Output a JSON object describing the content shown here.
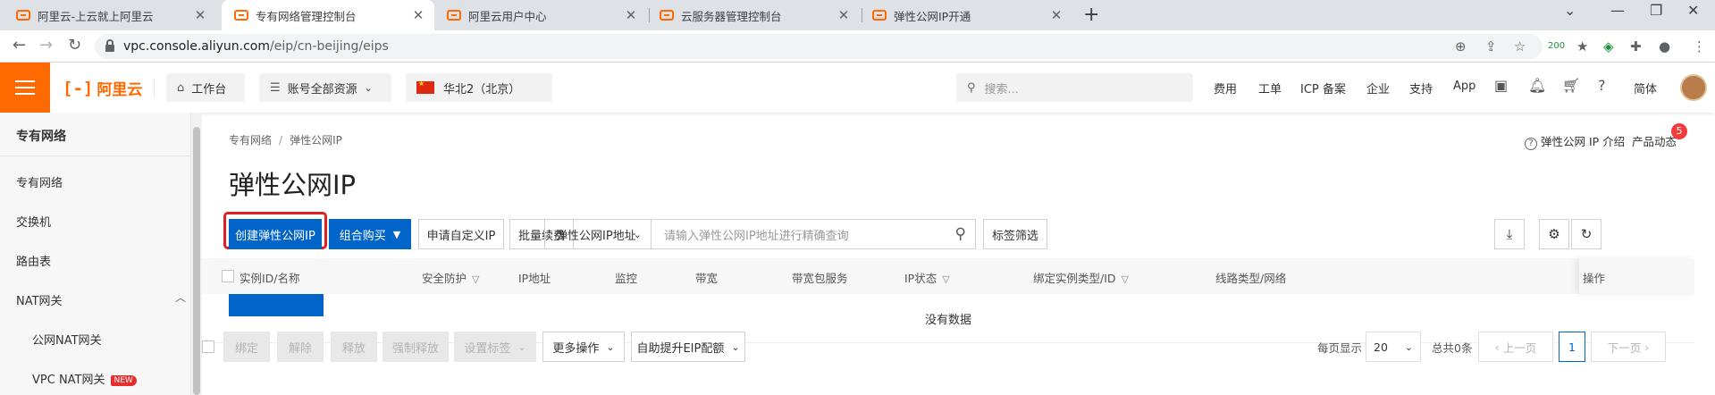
{
  "browser": {
    "tabs": [
      {
        "title": "阿里云-上云就上阿里云",
        "active": false
      },
      {
        "title": "专有网络管理控制台",
        "active": true
      },
      {
        "title": "阿里云用户中心",
        "active": false
      },
      {
        "title": "云服务器管理控制台",
        "active": false
      },
      {
        "title": "弹性公网IP开通",
        "active": false
      }
    ],
    "url_host": "vpc.console.aliyun.com",
    "url_path": "/eip/cn-beijing/eips",
    "ext_badge": "200"
  },
  "topnav": {
    "logo_text": "阿里云",
    "workbench": "工作台",
    "resources": "账号全部资源",
    "region": "华北2（北京）",
    "search_placeholder": "搜索...",
    "links": [
      "费用",
      "工单",
      "ICP 备案",
      "企业",
      "支持",
      "App"
    ],
    "lang": "简体"
  },
  "sidebar": {
    "title": "专有网络",
    "items": [
      "专有网络",
      "交换机",
      "路由表",
      "NAT网关"
    ],
    "sub_items": [
      "公网NAT网关",
      "VPC NAT网关"
    ],
    "new_badge": "NEW"
  },
  "main": {
    "breadcrumb": [
      "专有网络",
      "弹性公网IP"
    ],
    "intro_link": "弹性公网 IP 介绍",
    "news_link": "产品动态",
    "news_count": "5",
    "title": "弹性公网IP",
    "toolbar": {
      "create": "创建弹性公网IP",
      "combo_buy": "组合购买",
      "apply_custom": "申请自定义IP",
      "batch_renew": "批量续费",
      "filter_select": "弹性公网IP地址",
      "query_placeholder": "请输入弹性公网IP地址进行精确查询",
      "tag_filter": "标签筛选"
    },
    "columns": [
      "实例ID/名称",
      "安全防护",
      "IP地址",
      "监控",
      "带宽",
      "带宽包服务",
      "IP状态",
      "绑定实例类型/ID",
      "线路类型/网络",
      "操作"
    ],
    "empty_text": "没有数据",
    "bulk_actions": [
      "绑定",
      "解除",
      "释放",
      "强制释放",
      "设置标签"
    ],
    "more_ops": "更多操作",
    "auto_upgrade": "自助提升EIP配额",
    "pagination": {
      "per_page_label": "每页显示",
      "per_page": "20",
      "total": "总共0条",
      "prev": "上一页",
      "page": "1",
      "next": "下一页"
    }
  }
}
